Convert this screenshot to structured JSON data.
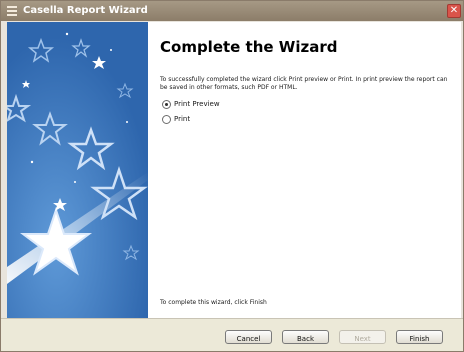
{
  "window": {
    "title": "Casella Report Wizard"
  },
  "content": {
    "heading": "Complete the Wizard",
    "description": "To successfully completed the wizard click Print preview or Print. In print preview the report can be saved in other formats, such PDF or HTML.",
    "options": [
      {
        "label": "Print Preview",
        "selected": true
      },
      {
        "label": "Print",
        "selected": false
      }
    ],
    "footer_note": "To complete this wizard, click Finish"
  },
  "buttons": {
    "cancel": "Cancel",
    "back": "Back",
    "next": "Next",
    "finish": "Finish"
  },
  "colors": {
    "side_panel": "#2f6bb2",
    "titlebar": "#8c7d69",
    "close": "#d9544a"
  }
}
